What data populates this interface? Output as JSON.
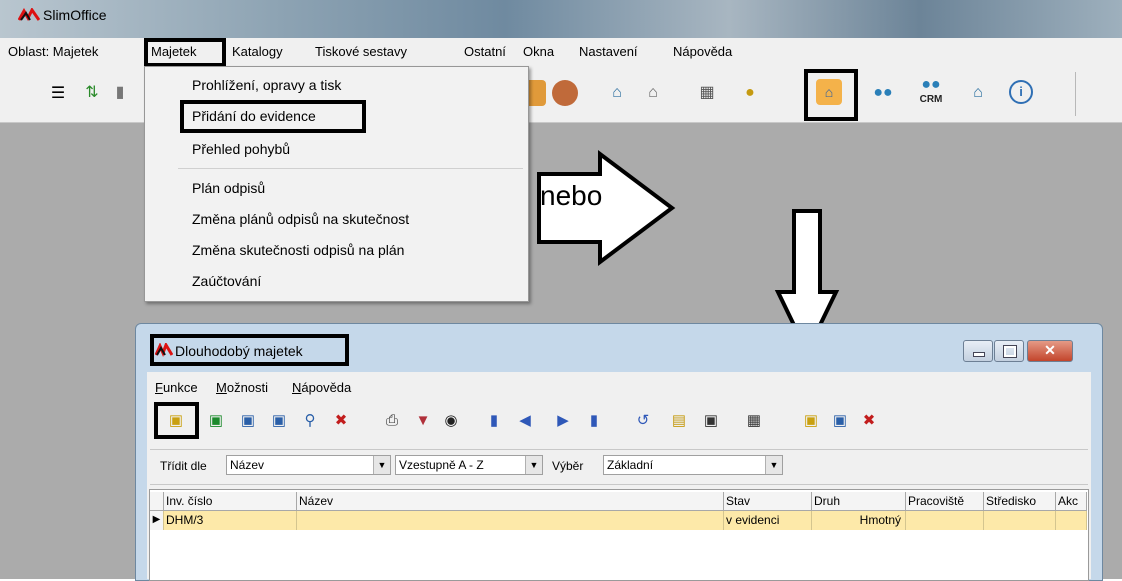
{
  "app": {
    "title": "SlimOffice"
  },
  "menubar": {
    "items": [
      "Oblast: Majetek",
      "Majetek",
      "Katalogy",
      "Tiskové sestavy",
      "Ostatní",
      "Okna",
      "Nastavení",
      "Nápověda"
    ]
  },
  "toolbar": {
    "icons": [
      "filter-icon",
      "balance-icon",
      "books-icon",
      "box-icon",
      "house-bank-icon",
      "house-money-icon",
      "calculator-icon",
      "money-bag-icon",
      "car-property-icon",
      "people-icon",
      "crm-icon",
      "contacts-house-icon",
      "info-icon"
    ],
    "crm_label": "CRM",
    "info_glyph": "i"
  },
  "dropdown": {
    "items": [
      "Prohlížení, opravy a tisk",
      "Přidání do evidence",
      "Přehled pohybů",
      "Plán odpisů",
      "Změna plánů odpisů na skutečnost",
      "Změna skutečnosti odpisů na plán",
      "Zaúčtování"
    ]
  },
  "annotation": {
    "nebo": "nebo"
  },
  "child_window": {
    "title": "Dlouhodobý majetek",
    "menu": [
      "Funkce",
      "Možnosti",
      "Nápověda"
    ],
    "menu_accel": [
      "F",
      "M",
      "N"
    ],
    "menu_rest": [
      "unkce",
      "ožnosti",
      "ápověda"
    ],
    "toolbar_icons": [
      "new-record-icon",
      "new-green-icon",
      "edit-icon",
      "search-icon",
      "delete-icon",
      "print-icon",
      "filter-icon",
      "binoculars-icon",
      "first-icon",
      "prev-icon",
      "next-icon",
      "last-icon",
      "refresh-icon",
      "table-icon",
      "report-icon",
      "export-icon",
      "new-small-icon",
      "edit-small-icon",
      "delete-small-icon"
    ],
    "filter": {
      "sort_label": "Třídit dle",
      "sort_value": "Název",
      "order_value": "Vzestupně A - Z",
      "select_label": "Výběr",
      "select_value": "Základní"
    },
    "grid": {
      "columns": [
        "Inv. číslo",
        "Název",
        "Stav",
        "Druh",
        "Pracoviště",
        "Středisko",
        "Akc"
      ],
      "rows": [
        [
          "DHM/3",
          "",
          "v evidenci",
          "Hmotný",
          "",
          "",
          ""
        ]
      ]
    }
  }
}
